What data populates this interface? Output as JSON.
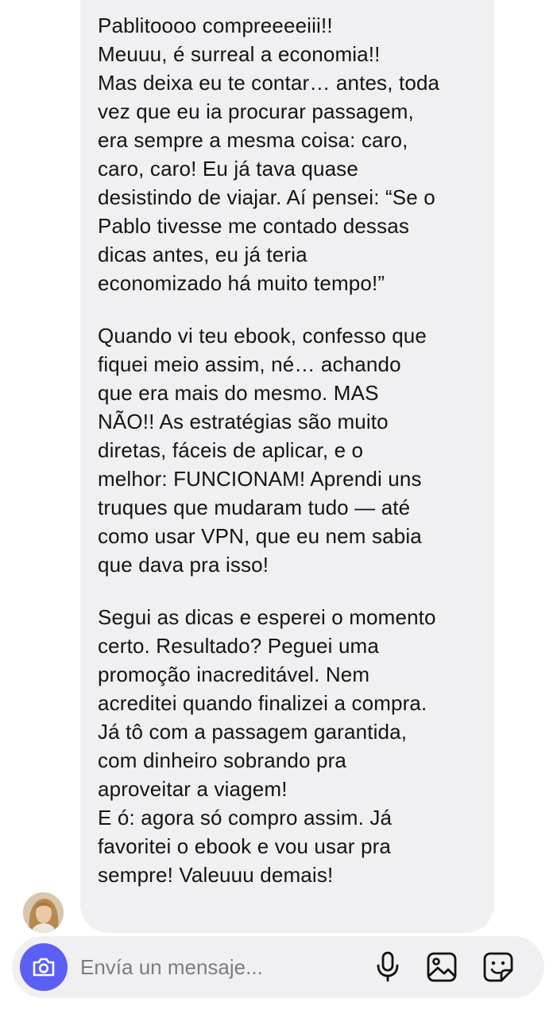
{
  "message": {
    "paragraphs": [
      "Pablitoooo compreeeeiii!!\nMeuuu, é surreal a economia!!\nMas deixa eu te contar… antes, toda\nvez que eu ia procurar passagem,\nera sempre a mesma coisa: caro,\ncaro, caro! Eu já tava quase\ndesistindo de viajar. Aí pensei: “Se o\nPablo tivesse me contado dessas\ndicas antes, eu já teria\neconomizado há muito tempo!”",
      "Quando vi teu ebook, confesso que\nfiquei meio assim, né… achando\nque era mais do mesmo. MAS\nNÃO!! As estratégias são muito\ndiretas, fáceis de aplicar, e o\nmelhor: FUNCIONAM! Aprendi uns\ntruques que mudaram tudo — até\ncomo usar VPN, que eu nem sabia\nque dava pra isso!",
      "Segui as dicas e esperei o momento\ncerto. Resultado? Peguei uma\npromoção inacreditável. Nem\nacreditei quando finalizei a compra.\nJá tô com a passagem garantida,\ncom dinheiro sobrando pra\naproveitar a viagem!\nE ó: agora só compro assim. Já\nfavoritei o ebook e vou usar pra\nsempre! Valeuuu demais!"
    ]
  },
  "composer": {
    "placeholder": "Envía un mensaje...",
    "icons": {
      "camera": "camera-icon",
      "mic": "microphone-icon",
      "gallery": "image-gallery-icon",
      "sticker": "sticker-icon"
    }
  },
  "colors": {
    "bubble_bg": "#f0f0f3",
    "camera_btn": "#5b5ff4",
    "text": "#141414",
    "placeholder": "#7d7d80"
  }
}
